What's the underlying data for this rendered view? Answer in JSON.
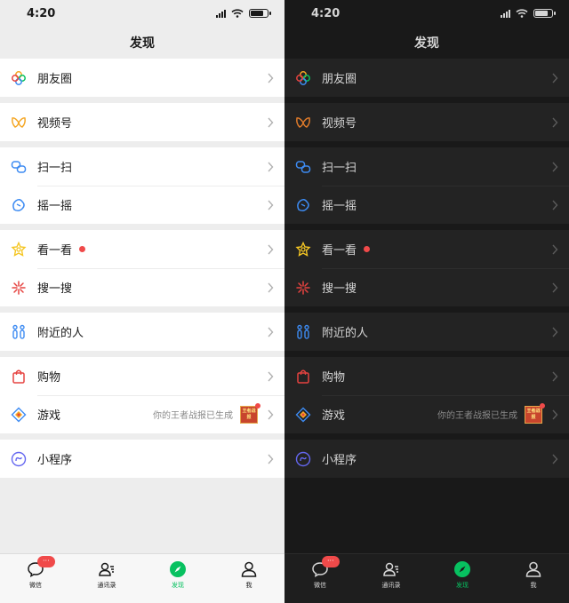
{
  "status": {
    "time": "4:20"
  },
  "header": {
    "title": "发现"
  },
  "items": {
    "moments": {
      "label": "朋友圈"
    },
    "channels": {
      "label": "视频号"
    },
    "scan": {
      "label": "扫一扫"
    },
    "shake": {
      "label": "摇一摇"
    },
    "top_stories": {
      "label": "看一看",
      "has_dot": true
    },
    "search": {
      "label": "搜一搜"
    },
    "nearby": {
      "label": "附近的人"
    },
    "shopping": {
      "label": "购物"
    },
    "games": {
      "label": "游戏",
      "subtitle": "你的王者战报已生成",
      "thumb_text": "王者战报"
    },
    "mini_programs": {
      "label": "小程序"
    }
  },
  "tabbar": {
    "chats": {
      "label": "微信",
      "badge": "···"
    },
    "contacts": {
      "label": "通讯录"
    },
    "discover": {
      "label": "发现",
      "active": true
    },
    "me": {
      "label": "我"
    }
  },
  "themes": [
    "light",
    "dark"
  ],
  "colors": {
    "accent": "#07c160",
    "badge": "#f04a4a",
    "light_bg": "#ededed",
    "dark_bg": "#191919"
  },
  "icons": {
    "moments": "aperture-icon",
    "channels": "butterfly-icon",
    "scan": "scan-icon",
    "shake": "shake-icon",
    "top_stories": "star-flower-icon",
    "search": "sparkle-icon",
    "nearby": "people-icon",
    "shopping": "shopping-bag-icon",
    "games": "diamond-icon",
    "mini_programs": "link-icon"
  }
}
